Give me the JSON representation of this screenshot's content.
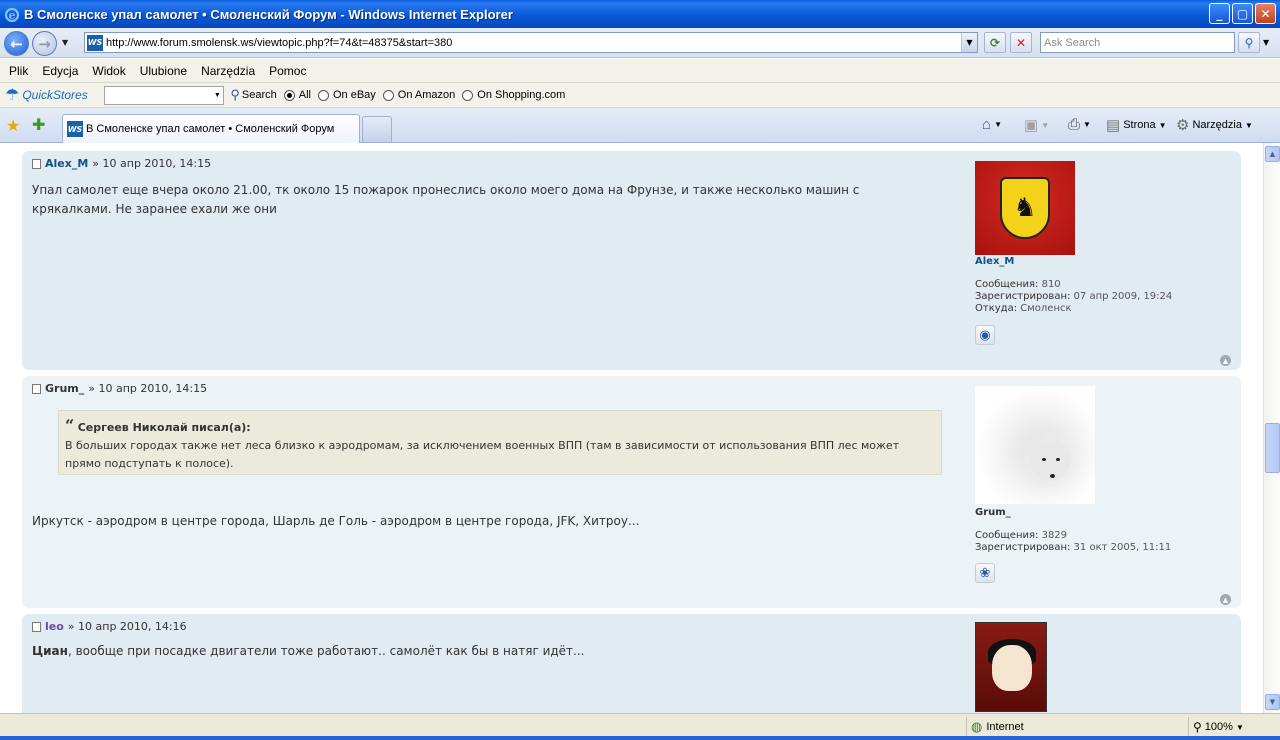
{
  "window": {
    "title": "В Смоленске упал самолет • Смоленский Форум - Windows Internet Explorer",
    "controls": {
      "minimize": "_",
      "maximize": "▢",
      "close": "✕"
    }
  },
  "address_bar": {
    "url": "http://www.forum.smolensk.ws/viewtopic.php?f=74&t=48375&start=380",
    "favicon_text": "WS",
    "search_placeholder": "Ask Search"
  },
  "menu": [
    "Plik",
    "Edycja",
    "Widok",
    "Ulubione",
    "Narzędzia",
    "Pomoc"
  ],
  "quickstores": {
    "name": "QuickStores",
    "search_label": "Search",
    "options": [
      {
        "label": "All",
        "selected": true
      },
      {
        "label": "On eBay",
        "selected": false
      },
      {
        "label": "On Amazon",
        "selected": false
      },
      {
        "label": "On Shopping.com",
        "selected": false
      }
    ]
  },
  "tabs": {
    "active_label": "В Смоленске упал самолет • Смоленский Форум",
    "favicon_text": "WS"
  },
  "command_bar": {
    "page_label": "Strona",
    "tools_label": "Narzędzia"
  },
  "posts": [
    {
      "author": "Alex_M",
      "date": "» 10 апр 2010, 14:15",
      "text": "Упал самолет еще вчера около 21.00, тк около 15 пожарок пронеслись около моего дома на Фрунзе, и также несколько машин с крякалками. Не заранее ехали же они",
      "profile": {
        "name": "Alex_M",
        "messages_label": "Сообщения:",
        "messages": "810",
        "registered_label": "Зарегистрирован:",
        "registered": "07 апр 2009, 19:24",
        "from_label": "Откуда:",
        "from": "Смоленск"
      }
    },
    {
      "author": "Grum_",
      "date": "» 10 апр 2010, 14:15",
      "quote_author": "Сергеев Николай писал(а):",
      "quote_text": "В больших городах также нет леса близко к аэродромам, за исключением военных ВПП (там в зависимости от использования ВПП лес может прямо подступать к полосе).",
      "text": "Иркутск - аэродром в центре города, Шарль де Голь - аэродром в центре города, JFK, Хитроу...",
      "profile": {
        "name": "Grum_",
        "messages_label": "Сообщения:",
        "messages": "3829",
        "registered_label": "Зарегистрирован:",
        "registered": "31 окт 2005, 11:11"
      }
    },
    {
      "author": "leo",
      "date": "» 10 апр 2010, 14:16",
      "text_bold": "Циан",
      "text": ", вообще при посадке двигатели тоже работают.. самолёт как бы в натяг идёт..."
    }
  ],
  "status_bar": {
    "zone": "Internet",
    "zoom": "100%"
  },
  "colors": {
    "accent": "#105289",
    "post_bg": "#e1ebf2",
    "post_alt_bg": "#ecf3f7",
    "quote_bg": "#ebeadd"
  }
}
